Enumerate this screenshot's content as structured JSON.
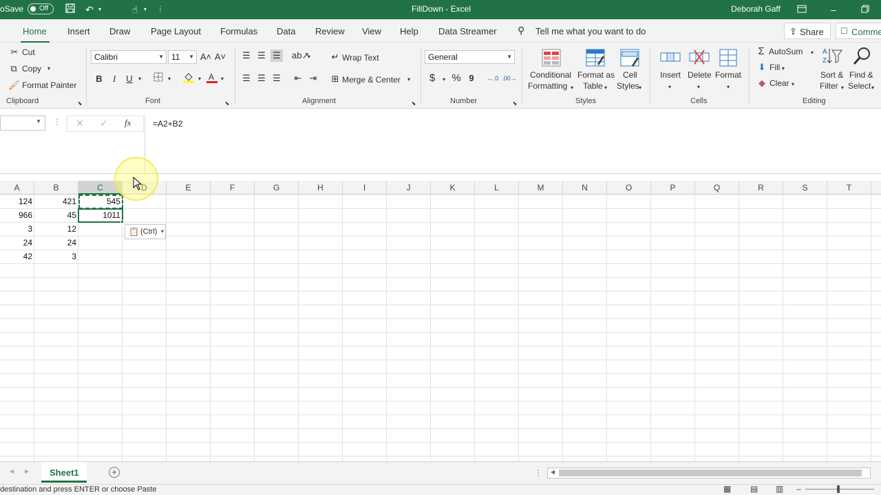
{
  "titlebar": {
    "autosave_label": "oSave",
    "autosave_state": "Off",
    "doc_title": "FillDown  -  Excel",
    "user": "Deborah Gaff"
  },
  "tabs": [
    "Home",
    "Insert",
    "Draw",
    "Page Layout",
    "Formulas",
    "Data",
    "Review",
    "View",
    "Help",
    "Data Streamer"
  ],
  "tell_me": "Tell me what you want to do",
  "share": "Share",
  "comments": "Comme",
  "clipboard": {
    "cut": "Cut",
    "copy": "Copy",
    "format_painter": "Format Painter",
    "group": "Clipboard"
  },
  "font": {
    "name": "Calibri",
    "size": "11",
    "bold": "B",
    "italic": "I",
    "underline": "U",
    "group": "Font",
    "grow": "A˄",
    "shrink": "A˅"
  },
  "alignment": {
    "wrap": "Wrap Text",
    "merge": "Merge & Center",
    "group": "Alignment"
  },
  "number": {
    "format": "General",
    "currency": "$",
    "percent": "%",
    "comma": "9",
    "group": "Number"
  },
  "styles": {
    "conditional_1": "Conditional",
    "conditional_2": "Formatting",
    "format_as_1": "Format as",
    "format_as_2": "Table",
    "cell_styles_1": "Cell",
    "cell_styles_2": "Styles",
    "group": "Styles"
  },
  "cells": {
    "insert": "Insert",
    "delete": "Delete",
    "format": "Format",
    "group": "Cells"
  },
  "editing": {
    "autosum": "AutoSum",
    "fill": "Fill",
    "clear": "Clear",
    "sort_1": "Sort &",
    "sort_2": "Filter",
    "find_1": "Find &",
    "find_2": "Select",
    "group": "Editing"
  },
  "formula_bar": {
    "fx": "fx",
    "formula": "=A2+B2"
  },
  "columns": [
    "A",
    "B",
    "C",
    "D",
    "E",
    "F",
    "G",
    "H",
    "I",
    "J",
    "K",
    "L",
    "M",
    "N",
    "O",
    "P",
    "Q",
    "R",
    "S",
    "T"
  ],
  "rows": [
    {
      "a": "124",
      "b": "421",
      "c": "545"
    },
    {
      "a": "966",
      "b": "45",
      "c": "1011"
    },
    {
      "a": "3",
      "b": "12",
      "c": ""
    },
    {
      "a": "24",
      "b": "24",
      "c": ""
    },
    {
      "a": "42",
      "b": "3",
      "c": ""
    }
  ],
  "paste_options": "(Ctrl)",
  "sheet_tab": "Sheet1",
  "status_text": "destination and press ENTER or choose Paste",
  "colors": {
    "excel_green": "#217346",
    "ribbon_bg": "#f3f3f3"
  }
}
